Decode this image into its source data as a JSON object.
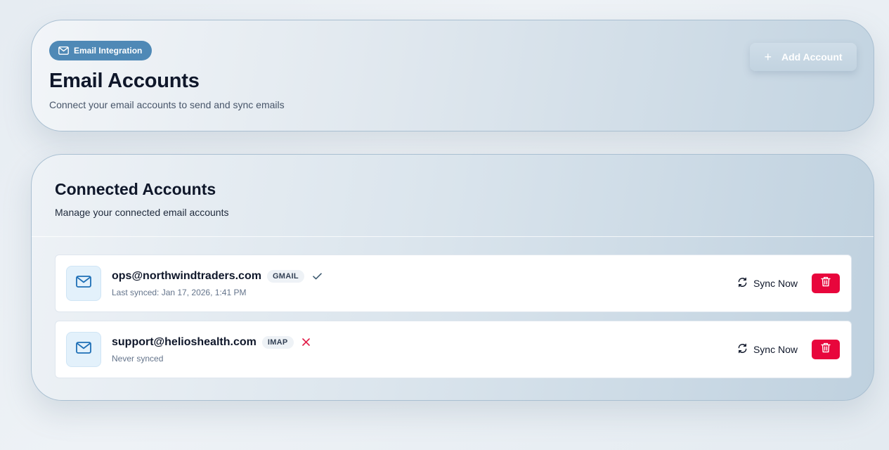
{
  "header": {
    "badge_label": "Email Integration",
    "title": "Email Accounts",
    "subtitle": "Connect your email accounts to send and sync emails",
    "add_button_label": "Add Account"
  },
  "connected": {
    "title": "Connected Accounts",
    "subtitle": "Manage your connected email accounts",
    "accounts": [
      {
        "email": "ops@northwindtraders.com",
        "type": "GMAIL",
        "status": "connected",
        "sync_text": "Last synced: Jan 17, 2026, 1:41 PM",
        "sync_button_label": "Sync Now"
      },
      {
        "email": "support@helioshealth.com",
        "type": "IMAP",
        "status": "error",
        "sync_text": "Never synced",
        "sync_button_label": "Sync Now"
      }
    ]
  },
  "colors": {
    "badge": "#4f89b6",
    "delete": "#e8063c",
    "status_error": "#e11d48"
  },
  "icons": {
    "badge": "mail-icon",
    "add": "plus-icon",
    "account": "mail-icon",
    "ok": "check-icon",
    "error": "x-icon",
    "sync": "refresh-icon",
    "delete": "trash-icon"
  }
}
